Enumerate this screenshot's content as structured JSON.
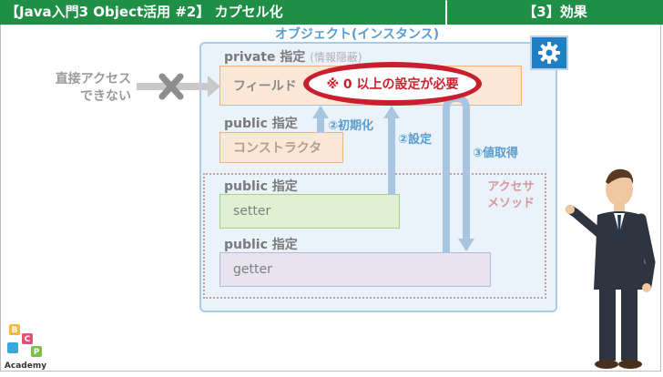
{
  "header": {
    "title": "【Java入門3 Object活用 #2】 カプセル化",
    "section": "【3】効果"
  },
  "outside": {
    "line1": "直接アクセス",
    "line2": "できない"
  },
  "object": {
    "title": "オブジェクト(インスタンス)",
    "private_label": "private 指定",
    "private_note": "(情報隠蔽)",
    "field": "フィールド",
    "constraint": "※ 0 以上の設定が必要",
    "public_ctor_label": "public 指定",
    "constructor": "コンストラクタ",
    "public_setter_label": "public 指定",
    "setter": "setter",
    "public_getter_label": "public 指定",
    "getter": "getter",
    "accessor_line1": "アクセサ",
    "accessor_line2": "メソッド"
  },
  "arrows": {
    "init": "②初期化",
    "set": "②設定",
    "get": "③値取得"
  },
  "logo": {
    "letters": [
      "B",
      "C",
      "P"
    ],
    "text": "Academy"
  },
  "colors": {
    "header_green": "#1f8f45",
    "highlight_red": "#c81e2e",
    "object_blue": "#eaf3fb",
    "arrow_blue": "#a8c6e2"
  }
}
